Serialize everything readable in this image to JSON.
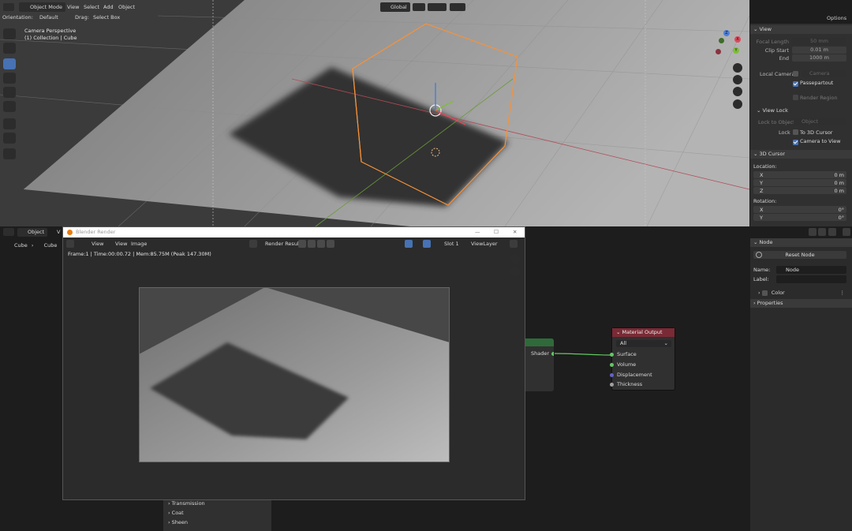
{
  "viewport3d": {
    "header": {
      "mode": "Object Mode",
      "menus": [
        "View",
        "Select",
        "Add",
        "Object"
      ],
      "transform_orientation": "Global",
      "options_label": "Options"
    },
    "tool_header": {
      "orientation_label": "Orientation:",
      "orientation_value": "Default",
      "drag_label": "Drag:",
      "drag_value": "Select Box"
    },
    "overlay_text": {
      "line1": "Camera Perspective",
      "line2": "(1) Collection | Cube"
    },
    "gizmo_axes": [
      "X",
      "Y",
      "Z"
    ]
  },
  "sidebar_view": {
    "view_title": "View",
    "focal_length_label": "Focal Length",
    "focal_length_value": "50 mm",
    "clip_start_label": "Clip Start",
    "clip_start_value": "0.01 m",
    "end_label": "End",
    "end_value": "1000 m",
    "local_camera_label": "Local Camera",
    "local_camera_value": "Camera",
    "passepartout_label": "Passepartout",
    "render_region_label": "Render Region",
    "view_lock_title": "View Lock",
    "lock_to_object_label": "Lock to Object",
    "lock_to_object_value": "Object",
    "lock_label": "Lock",
    "to_3d_cursor_label": "To 3D Cursor",
    "camera_to_view_label": "Camera to View",
    "cursor_title": "3D Cursor",
    "location_label": "Location:",
    "loc_x_label": "X",
    "loc_x_value": "0 m",
    "loc_y_label": "Y",
    "loc_y_value": "0 m",
    "loc_z_label": "Z",
    "loc_z_value": "0 m",
    "rotation_label": "Rotation:",
    "rot_x_label": "X",
    "rot_x_value": "0°",
    "rot_y_label": "Y",
    "rot_y_value": "0°"
  },
  "node_editor": {
    "header": {
      "object_label": "Object",
      "view_label": "V"
    },
    "breadcrumb": {
      "item1": "Cube",
      "item2": "Cube"
    },
    "material_output": {
      "title": "Material Output",
      "target": "All",
      "sockets": [
        "Surface",
        "Volume",
        "Displacement",
        "Thickness"
      ]
    },
    "bsdf_partial": {
      "output_label": "Shader",
      "panels": [
        "Transmission",
        "Coat",
        "Sheen"
      ]
    },
    "sidebar": {
      "node_title": "Node",
      "reset_button": "Reset Node",
      "name_label": "Name:",
      "name_value": "Node",
      "label_label": "Label:",
      "label_value": "",
      "color_label": "Color",
      "properties_title": "Properties"
    }
  },
  "render_window": {
    "title": "Blender Render",
    "menus": [
      "View",
      "View",
      "Image"
    ],
    "image_name": "Render Result",
    "slot": "Slot 1",
    "view_layer": "ViewLayer",
    "stats": "Frame:1 | Time:00:00.72 | Mem:85.75M (Peak 147.30M)",
    "win_min": "—",
    "win_max": "☐",
    "win_close": "✕"
  },
  "colors": {
    "accent_blue": "#4772b3",
    "selection_orange": "#f5923a",
    "material_output_header": "#7a2a35",
    "bsdf_header": "#2f6a3a",
    "socket_green": "#63c763",
    "socket_purple": "#6363c7",
    "socket_grey": "#a1a1a1"
  }
}
